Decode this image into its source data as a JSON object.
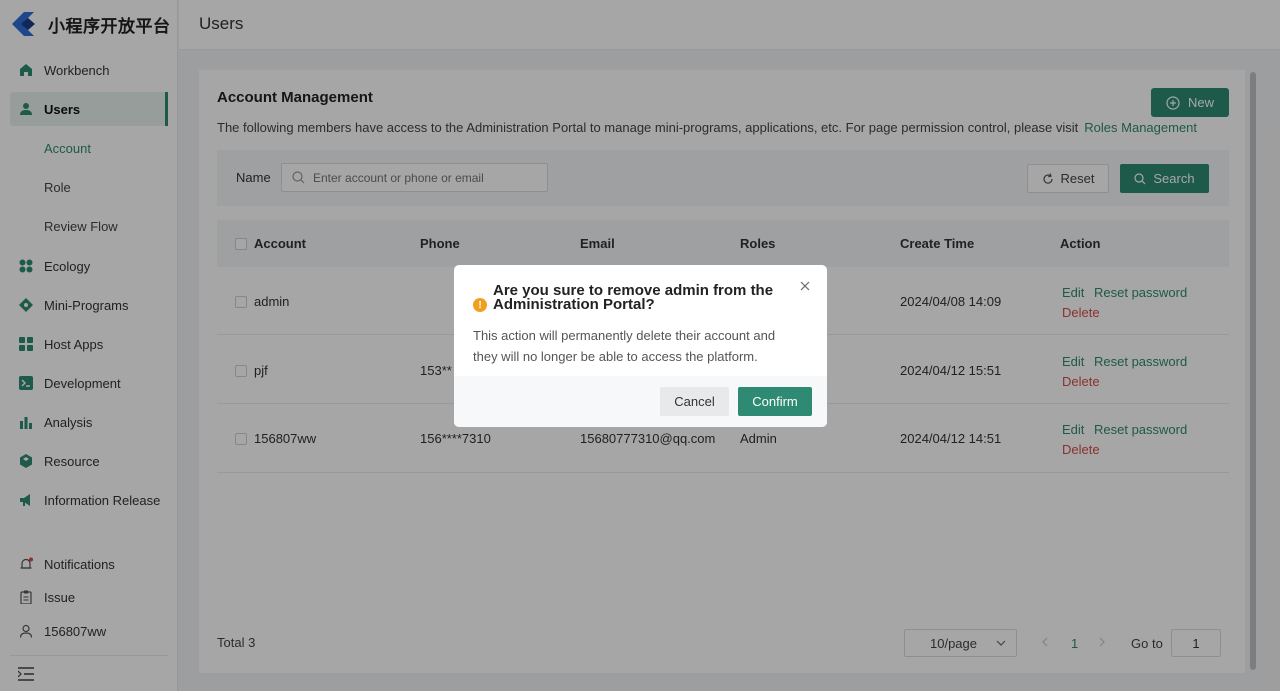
{
  "app": {
    "logo_text": "小程序开放平台",
    "page_title": "Users"
  },
  "sidebar": {
    "items": [
      {
        "label": "Workbench",
        "icon": "home-icon"
      },
      {
        "label": "Users",
        "icon": "user-icon"
      },
      {
        "label": "Ecology",
        "icon": "grid-icon"
      },
      {
        "label": "Mini-Programs",
        "icon": "diamond-icon"
      },
      {
        "label": "Host Apps",
        "icon": "apps-icon"
      },
      {
        "label": "Development",
        "icon": "terminal-icon"
      },
      {
        "label": "Analysis",
        "icon": "bar-chart-icon"
      },
      {
        "label": "Resource",
        "icon": "cube-icon"
      },
      {
        "label": "Information Release",
        "icon": "megaphone-icon"
      }
    ],
    "subitems": [
      "Account",
      "Role",
      "Review Flow"
    ],
    "bottom": [
      {
        "label": "Notifications",
        "icon": "bell-icon"
      },
      {
        "label": "Issue",
        "icon": "clipboard-icon"
      },
      {
        "label": "156807ww",
        "icon": "user-outline-icon"
      }
    ]
  },
  "main": {
    "title": "Account Management",
    "description": "The following members have access to the Administration Portal to manage mini-programs, applications, etc. For page permission control, please visit",
    "roles_link": "Roles Management",
    "new_label": "New",
    "filter": {
      "name_label": "Name",
      "search_placeholder": "Enter account or phone or email",
      "reset_label": "Reset",
      "search_label": "Search"
    },
    "columns": [
      "Account",
      "Phone",
      "Email",
      "Roles",
      "Create Time",
      "Action"
    ],
    "rows": [
      {
        "account": "admin",
        "phone": "",
        "email": "",
        "roles": "",
        "create_time": "2024/04/08 14:09"
      },
      {
        "account": "pjf",
        "phone": "153**",
        "email": "",
        "roles": "",
        "create_time": "2024/04/12 15:51"
      },
      {
        "account": "156807ww",
        "phone": "156****7310",
        "email": "15680777310@qq.com",
        "roles": "Admin",
        "create_time": "2024/04/12 14:51"
      }
    ],
    "actions": {
      "edit": "Edit",
      "reset_password": "Reset password",
      "delete": "Delete"
    },
    "total": "Total 3",
    "page_size": "10/page",
    "current_page": "1",
    "goto_label": "Go to",
    "goto_value": "1"
  },
  "modal": {
    "title": "Are you sure to remove admin from the Administration Portal?",
    "body": "This action will permanently delete their account and they will no longer be able to access the platform.",
    "cancel_label": "Cancel",
    "confirm_label": "Confirm"
  },
  "colors": {
    "accent": "#2e8a72",
    "danger": "#d94a4a",
    "warning": "#f0a020"
  }
}
